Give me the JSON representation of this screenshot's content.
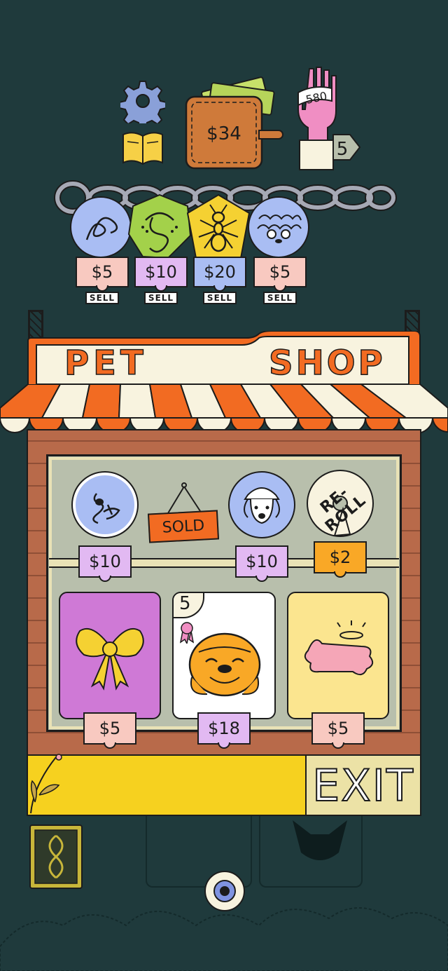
{
  "hud": {
    "money": "$34",
    "hand_count": "580",
    "level": "5"
  },
  "team": [
    {
      "price": "$5",
      "sell_label": "SELL",
      "color": "#a9bdf3",
      "icon": "scribble-icon"
    },
    {
      "price": "$10",
      "sell_label": "SELL",
      "color": "#a3d14a",
      "icon": "frog-face-icon"
    },
    {
      "price": "$20",
      "sell_label": "SELL",
      "color": "#f5d132",
      "icon": "ant-icon"
    },
    {
      "price": "$5",
      "sell_label": "SELL",
      "color": "#a9bdf3",
      "icon": "curly-dog-icon"
    }
  ],
  "shop": {
    "title_left": "PET",
    "title_right": "SHOP",
    "sold_label": "SOLD",
    "reroll_label": "RE-ROLL",
    "top_row": [
      {
        "price": "$10",
        "icon": "stretch-pet-icon"
      },
      {
        "price": "$10",
        "icon": "helmet-dog-icon"
      },
      {
        "price": "$2",
        "icon": "reroll-icon"
      }
    ],
    "cards": [
      {
        "price": "$5",
        "bg": "#cf79d6",
        "icon": "bow-icon",
        "level": ""
      },
      {
        "price": "$18",
        "bg": "#ffffff",
        "icon": "bulldog-icon",
        "level": "5"
      },
      {
        "price": "$5",
        "bg": "#fbe58f",
        "icon": "holy-bone-icon",
        "level": ""
      }
    ],
    "exit_label": "EXIT"
  },
  "colors": {
    "background": "#1f3a3c",
    "awning_orange": "#f26b22",
    "awning_cream": "#f8f3df",
    "brick": "#b86a4a",
    "shelf": "#b8bfac",
    "price_pink": "#f8c9c0",
    "price_lilac": "#e2b9f2",
    "price_orange": "#f9a826",
    "exit_bar": "#f6d11f"
  }
}
